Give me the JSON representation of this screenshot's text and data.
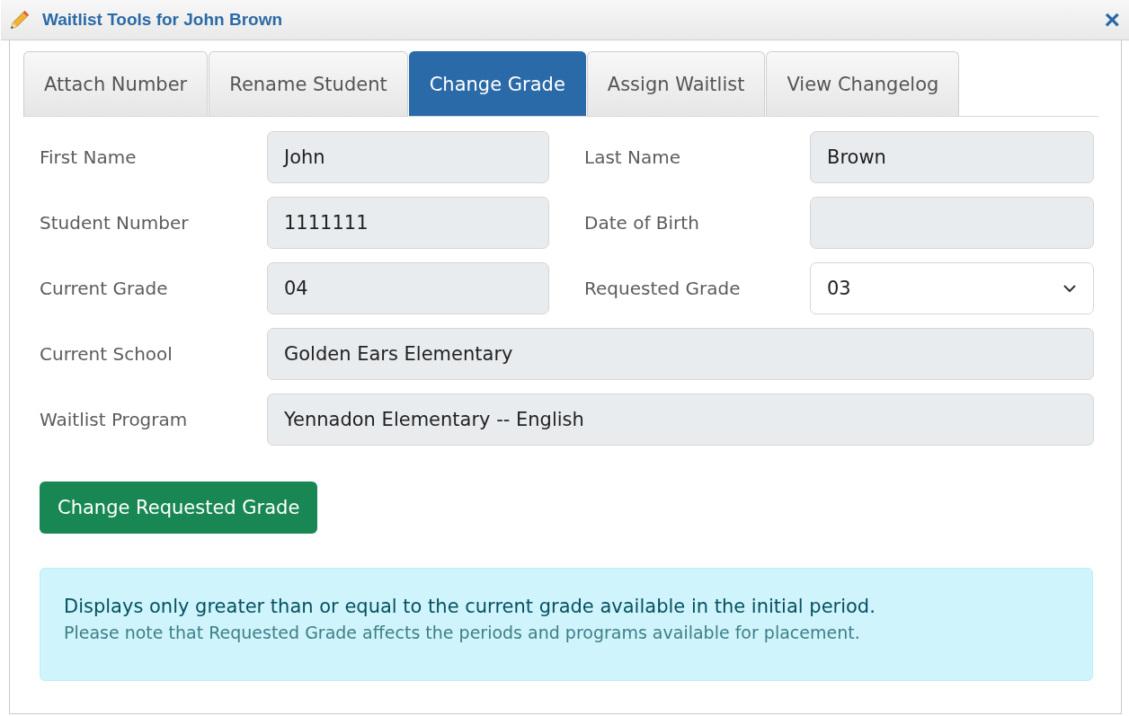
{
  "window": {
    "title": "Waitlist Tools for John Brown",
    "close": "×"
  },
  "tabs": [
    {
      "label": "Attach Number",
      "selected": false
    },
    {
      "label": "Rename Student",
      "selected": false
    },
    {
      "label": "Change Grade",
      "selected": true
    },
    {
      "label": "Assign Waitlist",
      "selected": false
    },
    {
      "label": "View Changelog",
      "selected": false
    }
  ],
  "form_rows": [
    {
      "fields": [
        {
          "label": "First Name",
          "value": "John",
          "kind": "readonly"
        },
        {
          "label": "Last Name",
          "value": "Brown",
          "kind": "readonly"
        }
      ]
    },
    {
      "fields": [
        {
          "label": "Student Number",
          "value": "1111111",
          "kind": "readonly"
        },
        {
          "label": "Date of Birth",
          "kind": "readonly"
        }
      ]
    },
    {
      "fields": [
        {
          "label": "Current Grade",
          "value": "04",
          "kind": "readonly"
        },
        {
          "label": "Requested Grade",
          "value": "03",
          "kind": "select"
        }
      ]
    },
    {
      "fields": [
        {
          "label": "Current School",
          "value": "Golden Ears Elementary",
          "kind": "readonly"
        }
      ]
    },
    {
      "fields": [
        {
          "label": "Waitlist Program",
          "value": "Yennadon Elementary -- English",
          "kind": "readonly"
        }
      ]
    }
  ],
  "submit_button": "Change Requested Grade",
  "info": {
    "heading": "Displays only greater than or equal to the current grade available in the initial period.",
    "note": "Please note that Requested Grade affects the periods and programs available for placement."
  }
}
